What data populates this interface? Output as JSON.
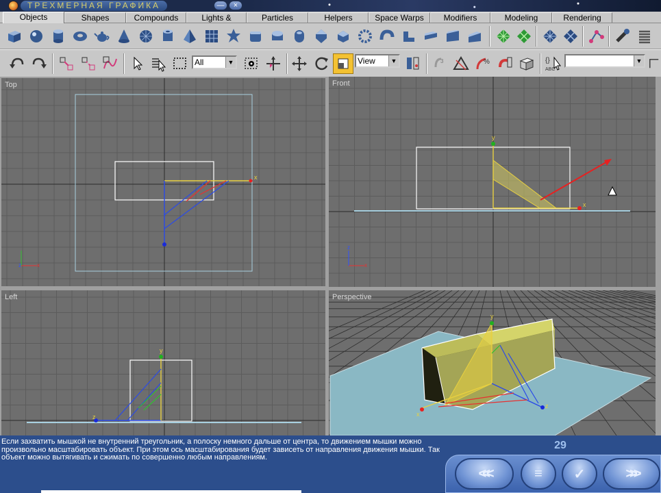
{
  "title": "ТРЕХМЕРНАЯ ГРАФИКА",
  "window_buttons": {
    "minimize": "—",
    "close": "×"
  },
  "tabs": [
    {
      "label": "Objects",
      "active": true
    },
    {
      "label": "Shapes"
    },
    {
      "label": "Compounds"
    },
    {
      "label": "Lights & Cameras"
    },
    {
      "label": "Particles"
    },
    {
      "label": "Helpers"
    },
    {
      "label": "Space Warps"
    },
    {
      "label": "Modifiers"
    },
    {
      "label": "Modeling"
    },
    {
      "label": "Rendering"
    }
  ],
  "toolbar1_icons": [
    "box-icon",
    "sphere-icon",
    "cylinder-icon",
    "torus-icon",
    "teapot-icon",
    "cone-icon",
    "geosphere-icon",
    "tube-icon",
    "pyramid-icon",
    "plane-icon",
    "hedra-icon",
    "chamfer-box-icon",
    "oil-tank-icon",
    "capsule-icon",
    "spindle-icon",
    "gengon-icon",
    "torus-knot-icon",
    "hose-icon",
    "l-ext-icon",
    "c-ext-icon",
    "prism-icon",
    "grid-icon",
    "grid-alt-icon",
    "lattice-icon",
    "lattice-alt-icon",
    "bones-icon",
    "stairs-icon",
    "spring-icon"
  ],
  "toolbar2": {
    "undo_icon": "undo-icon",
    "redo_icon": "redo-icon",
    "selection_filter": "All",
    "reference_coord": "View",
    "named_selection": ""
  },
  "viewports": {
    "top": "Top",
    "front": "Front",
    "left": "Left",
    "perspective": "Perspective"
  },
  "axis_labels": {
    "x": "x",
    "y": "y",
    "z": "z"
  },
  "description": "Если захватить мышкой не внутренний треугольник, а полоску немного дальше от центра, то движением мышки можно произвольно масштабировать объект. При этом ось масштабирования будет зависеть от направления движения мышки. Так объект можно вытягивать и сжимать по совершенно любым направлениям.",
  "page_number": "29",
  "nav": {
    "prev": "<<<",
    "menu": "≡",
    "check": "✓",
    "next": ">>>"
  },
  "colors": {
    "viewport_bg": "#6e6e6e",
    "grid": "#5a5a5a",
    "active_border": "#f4e83a",
    "panel": "#2c4e8c"
  }
}
